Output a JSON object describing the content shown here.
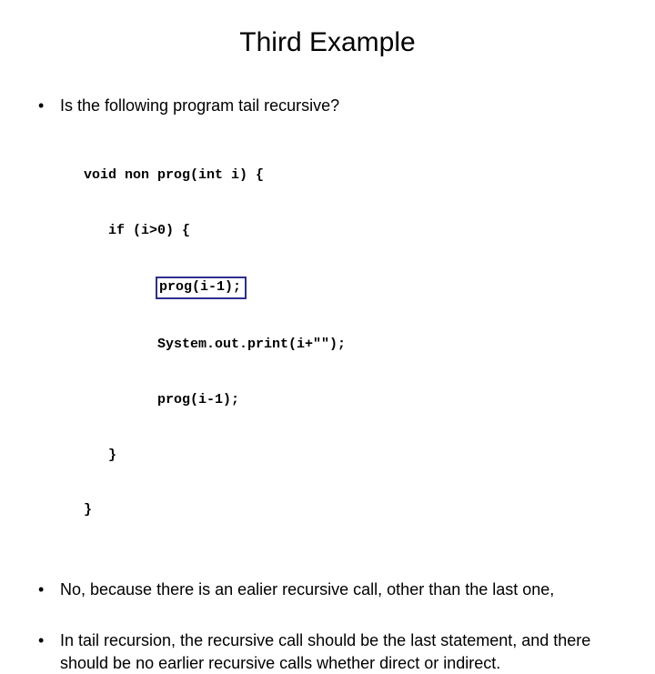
{
  "title": "Third Example",
  "bullets": {
    "b1": "Is the following program tail recursive?",
    "b2": "No, because there is an ealier recursive call, other than the last one,",
    "b3": "In tail recursion, the recursive call should be the last statement, and there should be no earlier recursive calls whether direct or indirect."
  },
  "code": {
    "l1": "void non prog(int i) {",
    "l2": "   if (i>0) {",
    "l3_indent": "         ",
    "l3_box": "prog(i-1);",
    "l4": "         System.out.print(i+\"\");",
    "l5": "         prog(i-1);",
    "l6": "   }",
    "l7": "}"
  }
}
